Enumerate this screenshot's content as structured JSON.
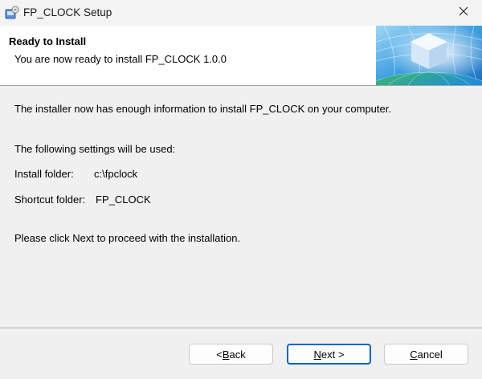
{
  "window": {
    "title": "FP_CLOCK Setup"
  },
  "banner": {
    "title": "Ready to Install",
    "subtitle": "You are now ready to install FP_CLOCK 1.0.0"
  },
  "main": {
    "intro": "The installer now has enough information to install FP_CLOCK on your computer.",
    "settings_heading": "The following settings will be used:",
    "install_folder_label": "Install folder:",
    "install_folder_value": "c:\\fpclock",
    "shortcut_folder_label": "Shortcut folder:",
    "shortcut_folder_value": "FP_CLOCK",
    "instruction": "Please click Next to proceed with the installation."
  },
  "buttons": {
    "back": {
      "prefix": "< ",
      "mnemonic": "B",
      "rest": "ack"
    },
    "next": {
      "prefix": "",
      "mnemonic": "N",
      "rest": "ext >"
    },
    "cancel": {
      "prefix": "",
      "mnemonic": "C",
      "rest": "ancel"
    }
  },
  "icons": {
    "app": "installer-icon",
    "close": "close-icon",
    "banner": "globe-cube-graphic"
  },
  "colors": {
    "default_button_border": "#0067c0"
  }
}
